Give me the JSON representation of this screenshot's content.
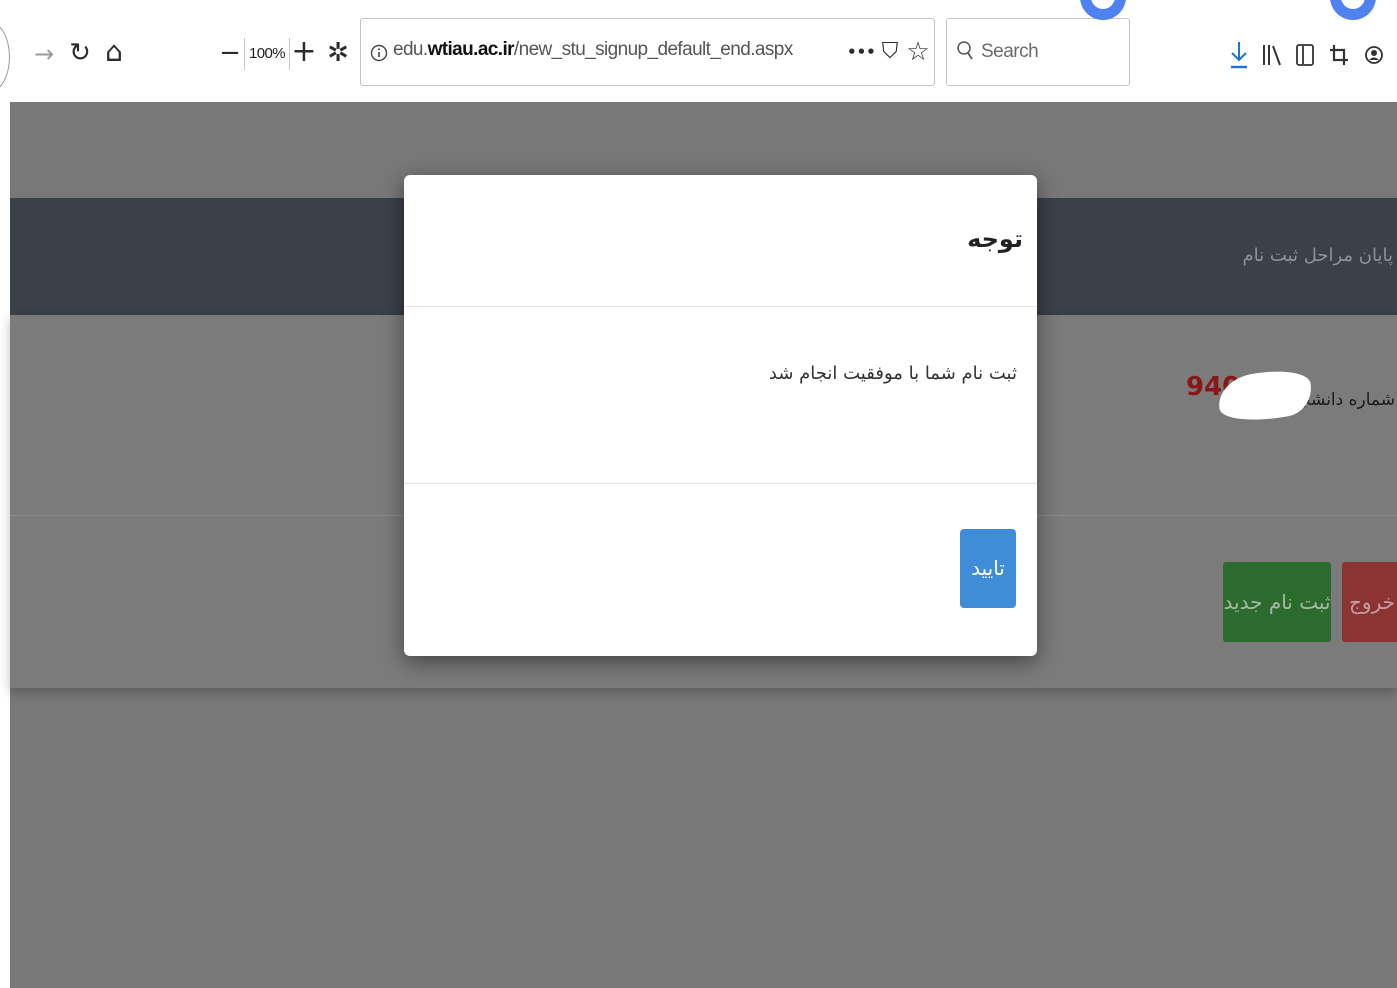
{
  "browser": {
    "zoom_level": "100%",
    "url_prefix": "edu.",
    "url_domain": "wtiau.ac.ir",
    "url_path": "/new_stu_signup_default_end.aspx",
    "search_placeholder": "Search",
    "icons": {
      "forward": "→",
      "reload": "↻",
      "home": "⌂",
      "zoom_out": "−",
      "zoom_in": "+",
      "settings": "✲",
      "page_actions": "•••",
      "pocket": "⛉",
      "bookmark_star": "☆",
      "search_glass": "⚲",
      "download": "⤓",
      "library": "⫴",
      "sidebar": "▣",
      "crop": "⌗",
      "account": "◉"
    },
    "accent_color": "#4f82f0"
  },
  "page": {
    "navbar_title": "پایان مراحل ثبت نام",
    "student_label": "شماره دانشجویی:",
    "student_number": "940",
    "buttons": {
      "new_signup": "ثبت نام جدید",
      "exit": "خروج"
    },
    "colors": {
      "new_signup": "#2d6a2d",
      "exit": "#8c3434",
      "student_number": "#8a1616"
    }
  },
  "modal": {
    "title": "توجه",
    "message": "ثبت نام شما با موفقیت انجام شد",
    "ok_label": "تایید",
    "ok_color": "#3f8dd8"
  }
}
